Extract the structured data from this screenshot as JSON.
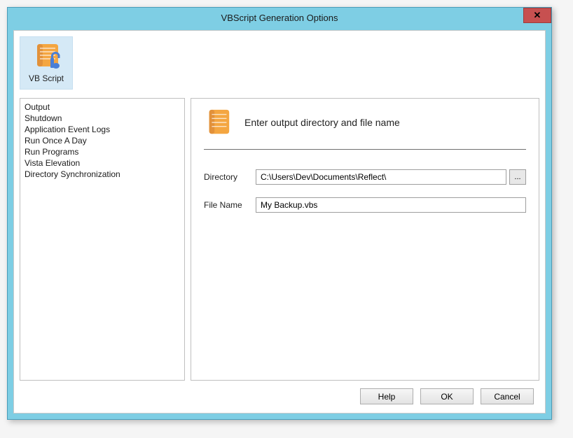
{
  "window": {
    "title": "VBScript Generation Options"
  },
  "icon_tile": {
    "label": "VB Script"
  },
  "sidebar": {
    "items": [
      "Output",
      "Shutdown",
      "Application Event Logs",
      "Run Once A Day",
      "Run Programs",
      "Vista Elevation",
      "Directory Synchronization"
    ]
  },
  "main": {
    "header": "Enter output directory and file name",
    "directory_label": "Directory",
    "directory_value": "C:\\Users\\Dev\\Documents\\Reflect\\",
    "filename_label": "File Name",
    "filename_value": "My Backup.vbs",
    "browse_label": "..."
  },
  "buttons": {
    "help": "Help",
    "ok": "OK",
    "cancel": "Cancel"
  }
}
